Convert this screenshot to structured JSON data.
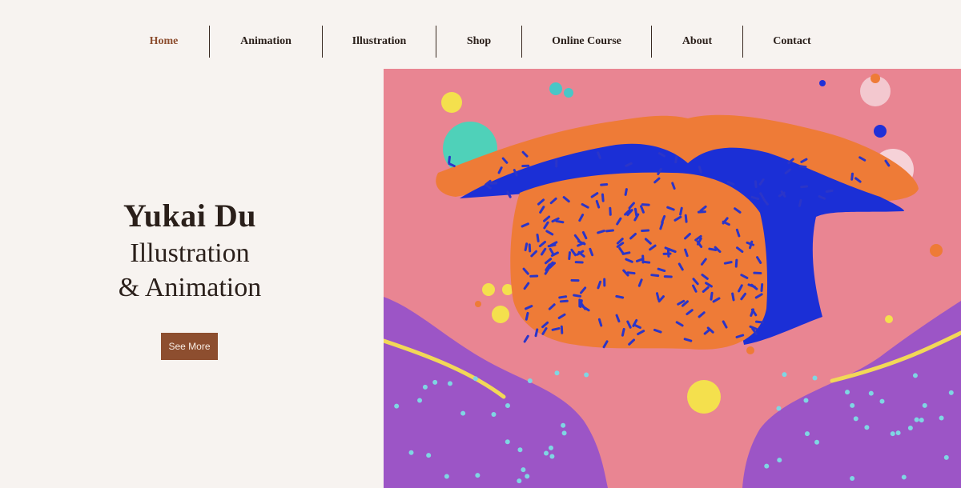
{
  "nav": {
    "items": [
      {
        "label": "Home",
        "active": true
      },
      {
        "label": "Animation",
        "active": false
      },
      {
        "label": "Illustration",
        "active": false
      },
      {
        "label": "Shop",
        "active": false
      },
      {
        "label": "Online Course",
        "active": false
      },
      {
        "label": "About",
        "active": false
      },
      {
        "label": "Contact",
        "active": false
      }
    ]
  },
  "hero": {
    "name": "Yukai Du",
    "line1": "Illustration",
    "line2": "& Animation",
    "cta_label": "See More"
  },
  "colors": {
    "background": "#f7f3f0",
    "accent": "#8d4e2f",
    "art_background": "#e98592",
    "art_orange": "#ee7b37",
    "art_blue": "#1b2fd6",
    "art_purple": "#9c55c6"
  }
}
